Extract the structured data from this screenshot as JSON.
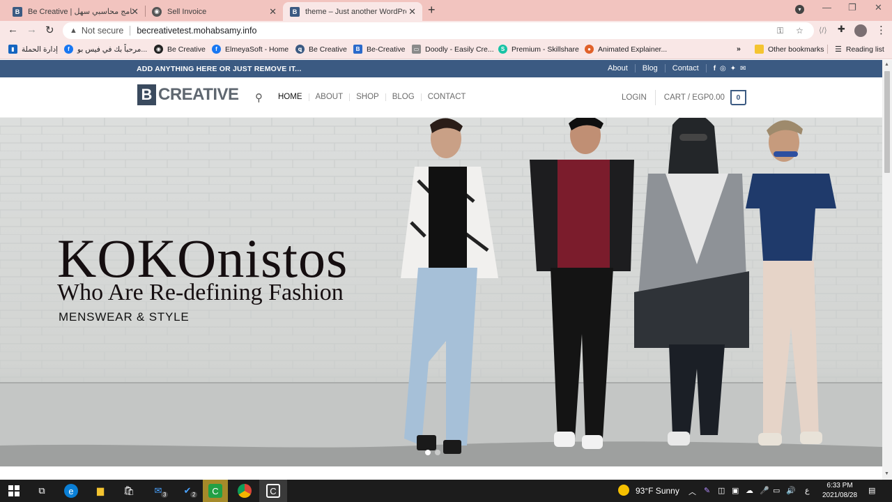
{
  "browser": {
    "tabs": [
      {
        "title": "Be Creative | برنامج محاسبي سهل"
      },
      {
        "title": "Sell Invoice"
      },
      {
        "title": "theme – Just another WordPress"
      }
    ],
    "address": {
      "security": "Not secure",
      "url": "becreativetest.mohabsamy.info"
    },
    "bookmarks": [
      {
        "label": "إدارة الحملة"
      },
      {
        "label": "مرحباً بك في فيس بو..."
      },
      {
        "label": "Be Creative"
      },
      {
        "label": "ElmeyaSoft - Home"
      },
      {
        "label": "Be Creative"
      },
      {
        "label": "Be-Creative"
      },
      {
        "label": "Doodly - Easily Cre..."
      },
      {
        "label": "Premium - Skillshare"
      },
      {
        "label": "Animated Explainer..."
      }
    ],
    "other_bookmarks": "Other bookmarks",
    "reading_list": "Reading list",
    "overflow": "»"
  },
  "site": {
    "topbar": {
      "notice": "ADD ANYTHING HERE OR JUST REMOVE IT...",
      "links": [
        "About",
        "Blog",
        "Contact"
      ]
    },
    "logo": {
      "mark": "B",
      "word": "CREATIVE"
    },
    "nav": [
      "HOME",
      "ABOUT",
      "SHOP",
      "BLOG",
      "CONTACT"
    ],
    "login": "LOGIN",
    "cart": {
      "label": "CART / EGP0.00",
      "count": "0"
    },
    "hero": {
      "title": "KOKOnistos",
      "subtitle": "Who Are Re-defining Fashion",
      "tagline": "MENSWEAR & STYLE"
    }
  },
  "taskbar": {
    "weather": "93°F  Sunny",
    "lang": "ع",
    "time": "6:33 PM",
    "date": "2021/08/28",
    "badges": [
      "3",
      "2"
    ]
  },
  "colors": {
    "brand": "#3b5a82",
    "tabstrip": "#f2c4bf",
    "toolbar": "#f9e7e6"
  }
}
